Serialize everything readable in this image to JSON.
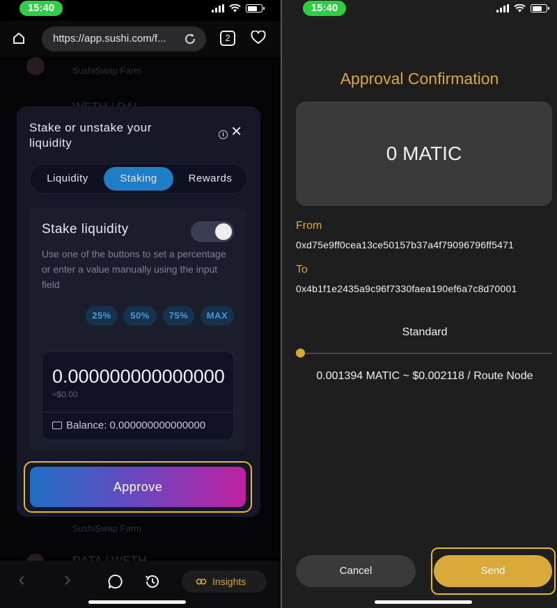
{
  "left_status": {
    "time": "15:40"
  },
  "browser": {
    "url": "https://app.sushi.com/f...",
    "tab_count": "2"
  },
  "background_list": {
    "items": [
      "SushiSwap Farm",
      "WETH / DAI",
      "SushiSwap Farm",
      "DATA / WETH"
    ]
  },
  "modal": {
    "title": "Stake or unstake your liquidity",
    "info_icon": "i",
    "close_icon": "×",
    "tabs": [
      {
        "label": "Liquidity",
        "active": false
      },
      {
        "label": "Staking",
        "active": true
      },
      {
        "label": "Rewards",
        "active": false
      }
    ],
    "card": {
      "title": "Stake liquidity",
      "toggle_on": true,
      "description": "Use one of the buttons to set a percentage or enter a value manually using the input field",
      "percent_buttons": [
        "25%",
        "50%",
        "75%",
        "MAX"
      ],
      "amount": "0.000000000000000",
      "usd_value": "≈$0.00",
      "balance": "Balance: 0.000000000000000"
    },
    "approve_label": "Approve"
  },
  "bottom_bar": {
    "insights_label": "Insights"
  },
  "right_status": {
    "time": "15:40"
  },
  "approval": {
    "title": "Approval Confirmation",
    "amount": "0 MATIC",
    "from_label": "From",
    "from_address": "0xd75e9ff0cea13ce50157b37a4f79096796ff5471",
    "to_label": "To",
    "to_address": "0x4b1f1e2435a9c96f7330faea190ef6a7c8d70001",
    "speed_label": "Standard",
    "speed_level": 0,
    "fee": "0.001394 MATIC ~ $0.002118 / Route Node",
    "cancel_label": "Cancel",
    "send_label": "Send"
  },
  "colors": {
    "accent_gold": "#d9a93b",
    "highlight_frame": "#e8b932",
    "staking_blue": "#1f7ec6",
    "status_green": "#2fcf45"
  },
  "icons": [
    "home-icon",
    "reload-icon",
    "heart-icon",
    "info-icon",
    "close-icon",
    "wallet-icon",
    "back-arrow-icon",
    "forward-arrow-icon",
    "chat-icon",
    "history-icon",
    "link-icon",
    "wifi-icon",
    "battery-icon",
    "signal-icon"
  ]
}
